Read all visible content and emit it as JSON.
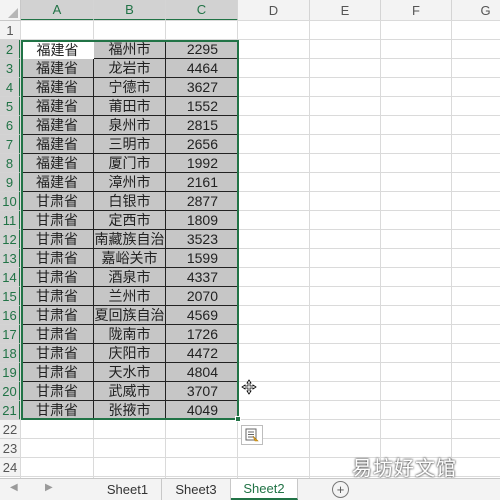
{
  "sheet": {
    "columns": [
      "A",
      "B",
      "C",
      "D",
      "E",
      "F",
      "G"
    ],
    "selected_columns": [
      "A",
      "B",
      "C"
    ],
    "row_numbers": [
      "1",
      "2",
      "3",
      "4",
      "5",
      "6",
      "7",
      "8",
      "9",
      "10",
      "11",
      "12",
      "13",
      "14",
      "15",
      "16",
      "17",
      "18",
      "19",
      "20",
      "21",
      "22",
      "23",
      "24"
    ],
    "selected_rows": [
      "2",
      "3",
      "4",
      "5",
      "6",
      "7",
      "8",
      "9",
      "10",
      "11",
      "12",
      "13",
      "14",
      "15",
      "16",
      "17",
      "18",
      "19",
      "20",
      "21"
    ],
    "cell_rows": [
      {
        "a": "福建省",
        "b": "福州市",
        "c": "2295"
      },
      {
        "a": "福建省",
        "b": "龙岩市",
        "c": "4464"
      },
      {
        "a": "福建省",
        "b": "宁德市",
        "c": "3627"
      },
      {
        "a": "福建省",
        "b": "莆田市",
        "c": "1552"
      },
      {
        "a": "福建省",
        "b": "泉州市",
        "c": "2815"
      },
      {
        "a": "福建省",
        "b": "三明市",
        "c": "2656"
      },
      {
        "a": "福建省",
        "b": "厦门市",
        "c": "1992"
      },
      {
        "a": "福建省",
        "b": "漳州市",
        "c": "2161"
      },
      {
        "a": "甘肃省",
        "b": "白银市",
        "c": "2877"
      },
      {
        "a": "甘肃省",
        "b": "定西市",
        "c": "1809"
      },
      {
        "a": "甘肃省",
        "b": "南藏族自治",
        "c": "3523"
      },
      {
        "a": "甘肃省",
        "b": "嘉峪关市",
        "c": "1599"
      },
      {
        "a": "甘肃省",
        "b": "酒泉市",
        "c": "4337"
      },
      {
        "a": "甘肃省",
        "b": "兰州市",
        "c": "2070"
      },
      {
        "a": "甘肃省",
        "b": "夏回族自治",
        "c": "4569"
      },
      {
        "a": "甘肃省",
        "b": "陇南市",
        "c": "1726"
      },
      {
        "a": "甘肃省",
        "b": "庆阳市",
        "c": "4472"
      },
      {
        "a": "甘肃省",
        "b": "天水市",
        "c": "4804"
      },
      {
        "a": "甘肃省",
        "b": "武威市",
        "c": "3707"
      },
      {
        "a": "甘肃省",
        "b": "张掖市",
        "c": "4049"
      }
    ]
  },
  "tabs": [
    {
      "label": "Sheet1",
      "active": false
    },
    {
      "label": "Sheet3",
      "active": false
    },
    {
      "label": "Sheet2",
      "active": true
    }
  ],
  "add_sheet_label": "+",
  "nav": {
    "prev": "◀",
    "next": "▶"
  },
  "watermark": "易坊好文馆",
  "colors": {
    "accent": "#217346",
    "selection_fill": "#c6c6c6"
  },
  "icons": {
    "quick_analysis": "quick-analysis-icon",
    "cursor": "move-cross-cursor-icon"
  }
}
